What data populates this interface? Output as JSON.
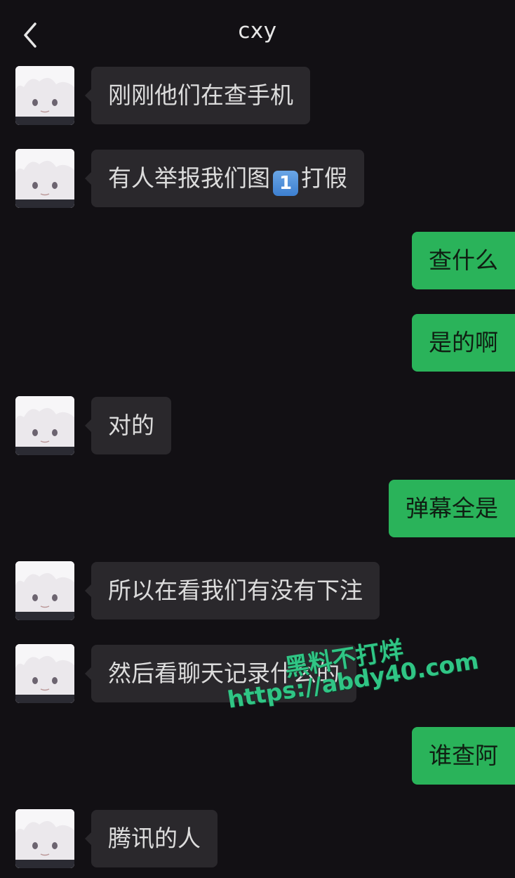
{
  "header": {
    "title": "cxy",
    "back_icon": "chevron-left-icon"
  },
  "colors": {
    "background": "#121014",
    "incoming_bubble": "#2a282c",
    "outgoing_bubble": "#2ab35a",
    "watermark": "#30c585"
  },
  "messages": [
    {
      "side": "in",
      "text": "刚刚他们在查手机"
    },
    {
      "side": "in",
      "text_before": "有人举报我们图",
      "emoji": "1",
      "emoji_name": "keycap-one-emoji",
      "text_after": "打假"
    },
    {
      "side": "out",
      "text": "查什么"
    },
    {
      "side": "out",
      "text": "是的啊"
    },
    {
      "side": "in",
      "text": "对的"
    },
    {
      "side": "out",
      "text": "弹幕全是"
    },
    {
      "side": "in",
      "text": "所以在看我们有没有下注"
    },
    {
      "side": "in",
      "text": "然后看聊天记录什么的"
    },
    {
      "side": "out",
      "text": "谁查阿"
    },
    {
      "side": "in",
      "text": "腾讯的人"
    }
  ],
  "watermark": {
    "line1": "黑料不打烊",
    "line2": "https://abdy40.com"
  }
}
